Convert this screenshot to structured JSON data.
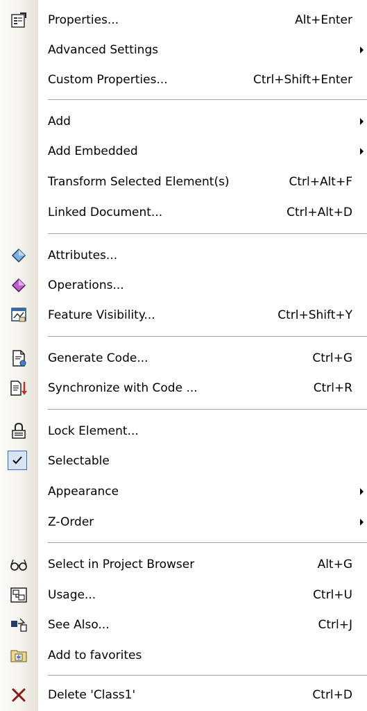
{
  "menu": {
    "items": [
      {
        "label": "Properties...",
        "shortcut": "Alt+Enter",
        "icon": "properties-icon"
      },
      {
        "label": "Advanced Settings",
        "submenu": true
      },
      {
        "label": "Custom Properties...",
        "shortcut": "Ctrl+Shift+Enter"
      },
      {
        "label": "Add",
        "submenu": true
      },
      {
        "label": "Add Embedded",
        "submenu": true
      },
      {
        "label": "Transform Selected Element(s)",
        "shortcut": "Ctrl+Alt+F"
      },
      {
        "label": "Linked Document...",
        "shortcut": "Ctrl+Alt+D"
      },
      {
        "label": "Attributes...",
        "icon": "attributes-icon"
      },
      {
        "label": "Operations...",
        "icon": "operations-icon"
      },
      {
        "label": "Feature Visibility...",
        "shortcut": "Ctrl+Shift+Y",
        "icon": "feature-visibility-icon"
      },
      {
        "label": "Generate Code...",
        "shortcut": "Ctrl+G",
        "icon": "generate-code-icon"
      },
      {
        "label": "Synchronize with Code ...",
        "shortcut": "Ctrl+R",
        "icon": "synchronize-icon"
      },
      {
        "label": "Lock Element...",
        "icon": "lock-icon"
      },
      {
        "label": "Selectable",
        "checked": true,
        "icon": "checkmark-icon"
      },
      {
        "label": "Appearance",
        "submenu": true
      },
      {
        "label": "Z-Order",
        "submenu": true
      },
      {
        "label": "Select in Project Browser",
        "shortcut": "Alt+G",
        "icon": "glasses-icon"
      },
      {
        "label": "Usage...",
        "shortcut": "Ctrl+U",
        "icon": "usage-icon"
      },
      {
        "label": "See Also...",
        "shortcut": "Ctrl+J",
        "icon": "see-also-icon"
      },
      {
        "label": "Add to favorites",
        "icon": "favorites-folder-icon"
      },
      {
        "label": "Delete 'Class1'",
        "shortcut": "Ctrl+D",
        "icon": "delete-x-icon"
      }
    ]
  },
  "colors": {
    "delete_icon": "#8b1a1a",
    "attributes_icon": "#7fb2e0",
    "operations_icon": "#c060d0",
    "check_highlight": "#d6e4f5"
  }
}
